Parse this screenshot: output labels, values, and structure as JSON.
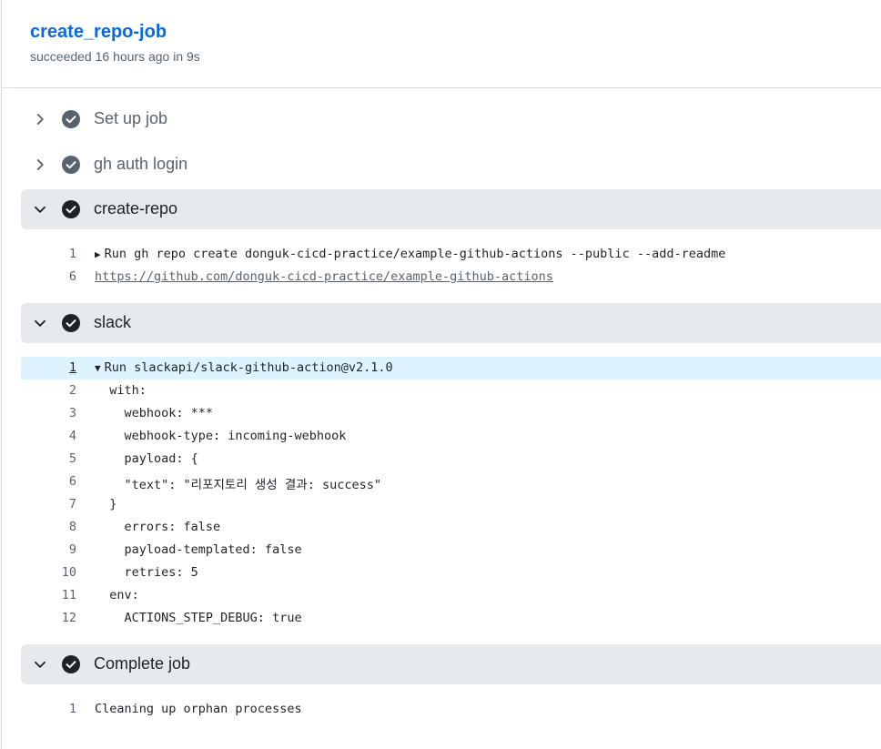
{
  "job": {
    "title": "create_repo-job",
    "subtitle": "succeeded 16 hours ago in 9s"
  },
  "steps": [
    {
      "label": "Set up job",
      "expanded": false
    },
    {
      "label": "gh auth login",
      "expanded": false
    },
    {
      "label": "create-repo",
      "expanded": true,
      "lines": [
        {
          "num": "1",
          "toggle": "▶",
          "text": "Run gh repo create donguk-cicd-practice/example-github-actions --public --add-readme"
        },
        {
          "num": "6",
          "text": "https://github.com/donguk-cicd-practice/example-github-actions",
          "link": true
        }
      ]
    },
    {
      "label": "slack",
      "expanded": true,
      "lines": [
        {
          "num": "1",
          "toggle": "▼",
          "text": "Run slackapi/slack-github-action@v2.1.0",
          "highlight": true
        },
        {
          "num": "2",
          "text": "  with:"
        },
        {
          "num": "3",
          "text": "    webhook: ***"
        },
        {
          "num": "4",
          "text": "    webhook-type: incoming-webhook"
        },
        {
          "num": "5",
          "text": "    payload: {"
        },
        {
          "num": "6",
          "text": "    \"text\": \"리포지토리 생성 결과: success\""
        },
        {
          "num": "7",
          "text": "  }"
        },
        {
          "num": "8",
          "text": "    errors: false"
        },
        {
          "num": "9",
          "text": "    payload-templated: false"
        },
        {
          "num": "10",
          "text": "    retries: 5"
        },
        {
          "num": "11",
          "text": "  env:"
        },
        {
          "num": "12",
          "text": "    ACTIONS_STEP_DEBUG: true"
        }
      ]
    },
    {
      "label": "Complete job",
      "expanded": true,
      "lines": [
        {
          "num": "1",
          "text": "Cleaning up orphan processes"
        }
      ]
    }
  ],
  "colors": {
    "accent": "#0969da",
    "check_collapsed": "#59636e",
    "check_expanded": "#1f2328",
    "highlight_row": "#ddf4ff"
  },
  "icons": {
    "collapsed": "chevron-right-icon",
    "expanded": "chevron-down-icon",
    "status": "check-circle-icon"
  }
}
